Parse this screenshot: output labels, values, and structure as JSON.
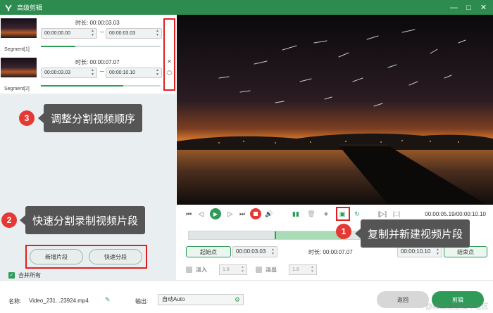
{
  "window": {
    "title": "高级剪辑",
    "minimize": "—",
    "maximize": "□",
    "close": "✕"
  },
  "segments": [
    {
      "label": "Segment[1]",
      "duration": "时长: 00:00:03.03",
      "start": "00:00:00.00",
      "end": "00:00:03.03",
      "progress": 0.29
    },
    {
      "label": "Segment[2]",
      "duration": "时长: 00:00:07.07",
      "start": "00:00:03.03",
      "end": "00:00:10.10",
      "progress": 0.69
    }
  ],
  "segment_side": {
    "close": "✕",
    "up": "︿",
    "down": "﹀"
  },
  "callouts": [
    {
      "num": "3",
      "text": "调整分割视频顺序"
    },
    {
      "num": "2",
      "text": "快速分割录制视频片段"
    },
    {
      "num": "1",
      "text": "复制并新建视频片段"
    }
  ],
  "left_buttons": {
    "add_segment": "新增片段",
    "quick_split": "快速分段"
  },
  "merge_all": "合并所有",
  "player": {
    "timecode": "00:00:05.19/00:00:10.10"
  },
  "trim": {
    "start_label": "起始点",
    "start_value": "00:00:03.03",
    "duration": "时长: 00:00:07.07",
    "end_value": "00:00:10.10",
    "end_label": "结束点"
  },
  "fade_in": {
    "label": "淡入",
    "value": "1.8"
  },
  "fade_out": {
    "label": "淡出",
    "value": "1.8"
  },
  "bottom": {
    "name_label": "名称:",
    "file_name": "Video_231...23924.mp4",
    "output_label": "输出:",
    "output_value": "自动Auto",
    "back": "返回",
    "cut": "剪辑",
    "watermark": "@稀土掘金技术社区"
  },
  "colors": {
    "accent": "#2e9b58",
    "titlebar": "#2e8b4f",
    "highlight": "#e02020"
  }
}
